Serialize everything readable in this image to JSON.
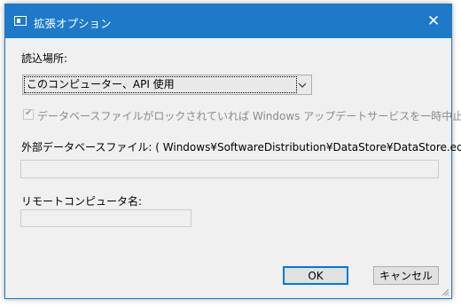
{
  "window": {
    "title": "拡張オプション",
    "close_symbol": "✕",
    "app_icon": "window-icon"
  },
  "location": {
    "label": "読込場所:",
    "selected": "このコンピューター、API 使用",
    "arrow_icon": "chevron-down-icon"
  },
  "lock_option": {
    "checked": true,
    "enabled": false,
    "label": "データベースファイルがロックされていれば Windows アップデートサービスを一時中止する"
  },
  "external_db": {
    "label": "外部データベースファイル: ( Windows¥SoftwareDistribution¥DataStore¥DataStore.edb )",
    "value": ""
  },
  "remote": {
    "label": "リモートコンピュータ名:",
    "value": ""
  },
  "buttons": {
    "ok": "OK",
    "cancel": "キャンセル"
  },
  "colors": {
    "titlebar": "#1e79c9",
    "dialog_bg": "#f0f0f0",
    "default_button_border": "#0078d7"
  }
}
